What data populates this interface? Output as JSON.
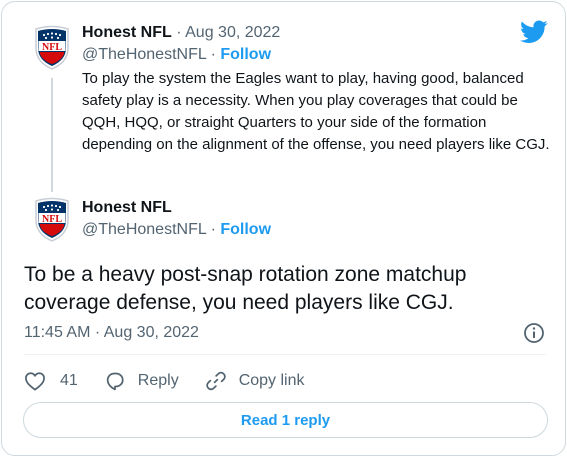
{
  "quoted_tweet": {
    "author_name": "Honest NFL",
    "separator": " · ",
    "date": "Aug 30, 2022",
    "handle": "@TheHonestNFL",
    "handle_separator": " · ",
    "follow_label": "Follow",
    "text": "To play the system the Eagles want to play, having good, balanced safety play is a necessity. When you play coverages that could be QQH, HQQ, or straight Quarters to your side of the formation depending on the alignment of the offense, you need players like CGJ.",
    "avatar_icon": "nfl-shield-logo"
  },
  "main_tweet": {
    "author_name": "Honest NFL",
    "handle": "@TheHonestNFL",
    "handle_separator": " · ",
    "follow_label": "Follow",
    "text": "To be a heavy post-snap rotation zone matchup coverage defense, you need players like CGJ.",
    "timestamp": "11:45 AM · Aug 30, 2022",
    "avatar_icon": "nfl-shield-logo"
  },
  "actions": {
    "like_count": "41",
    "reply_label": "Reply",
    "copy_link_label": "Copy link"
  },
  "read_reply_label": "Read 1 reply",
  "colors": {
    "accent": "#1d9bf0",
    "text": "#0f1419",
    "muted": "#536471",
    "border": "#cfd9de",
    "nfl_blue": "#013369",
    "nfl_red": "#d50a0a"
  }
}
